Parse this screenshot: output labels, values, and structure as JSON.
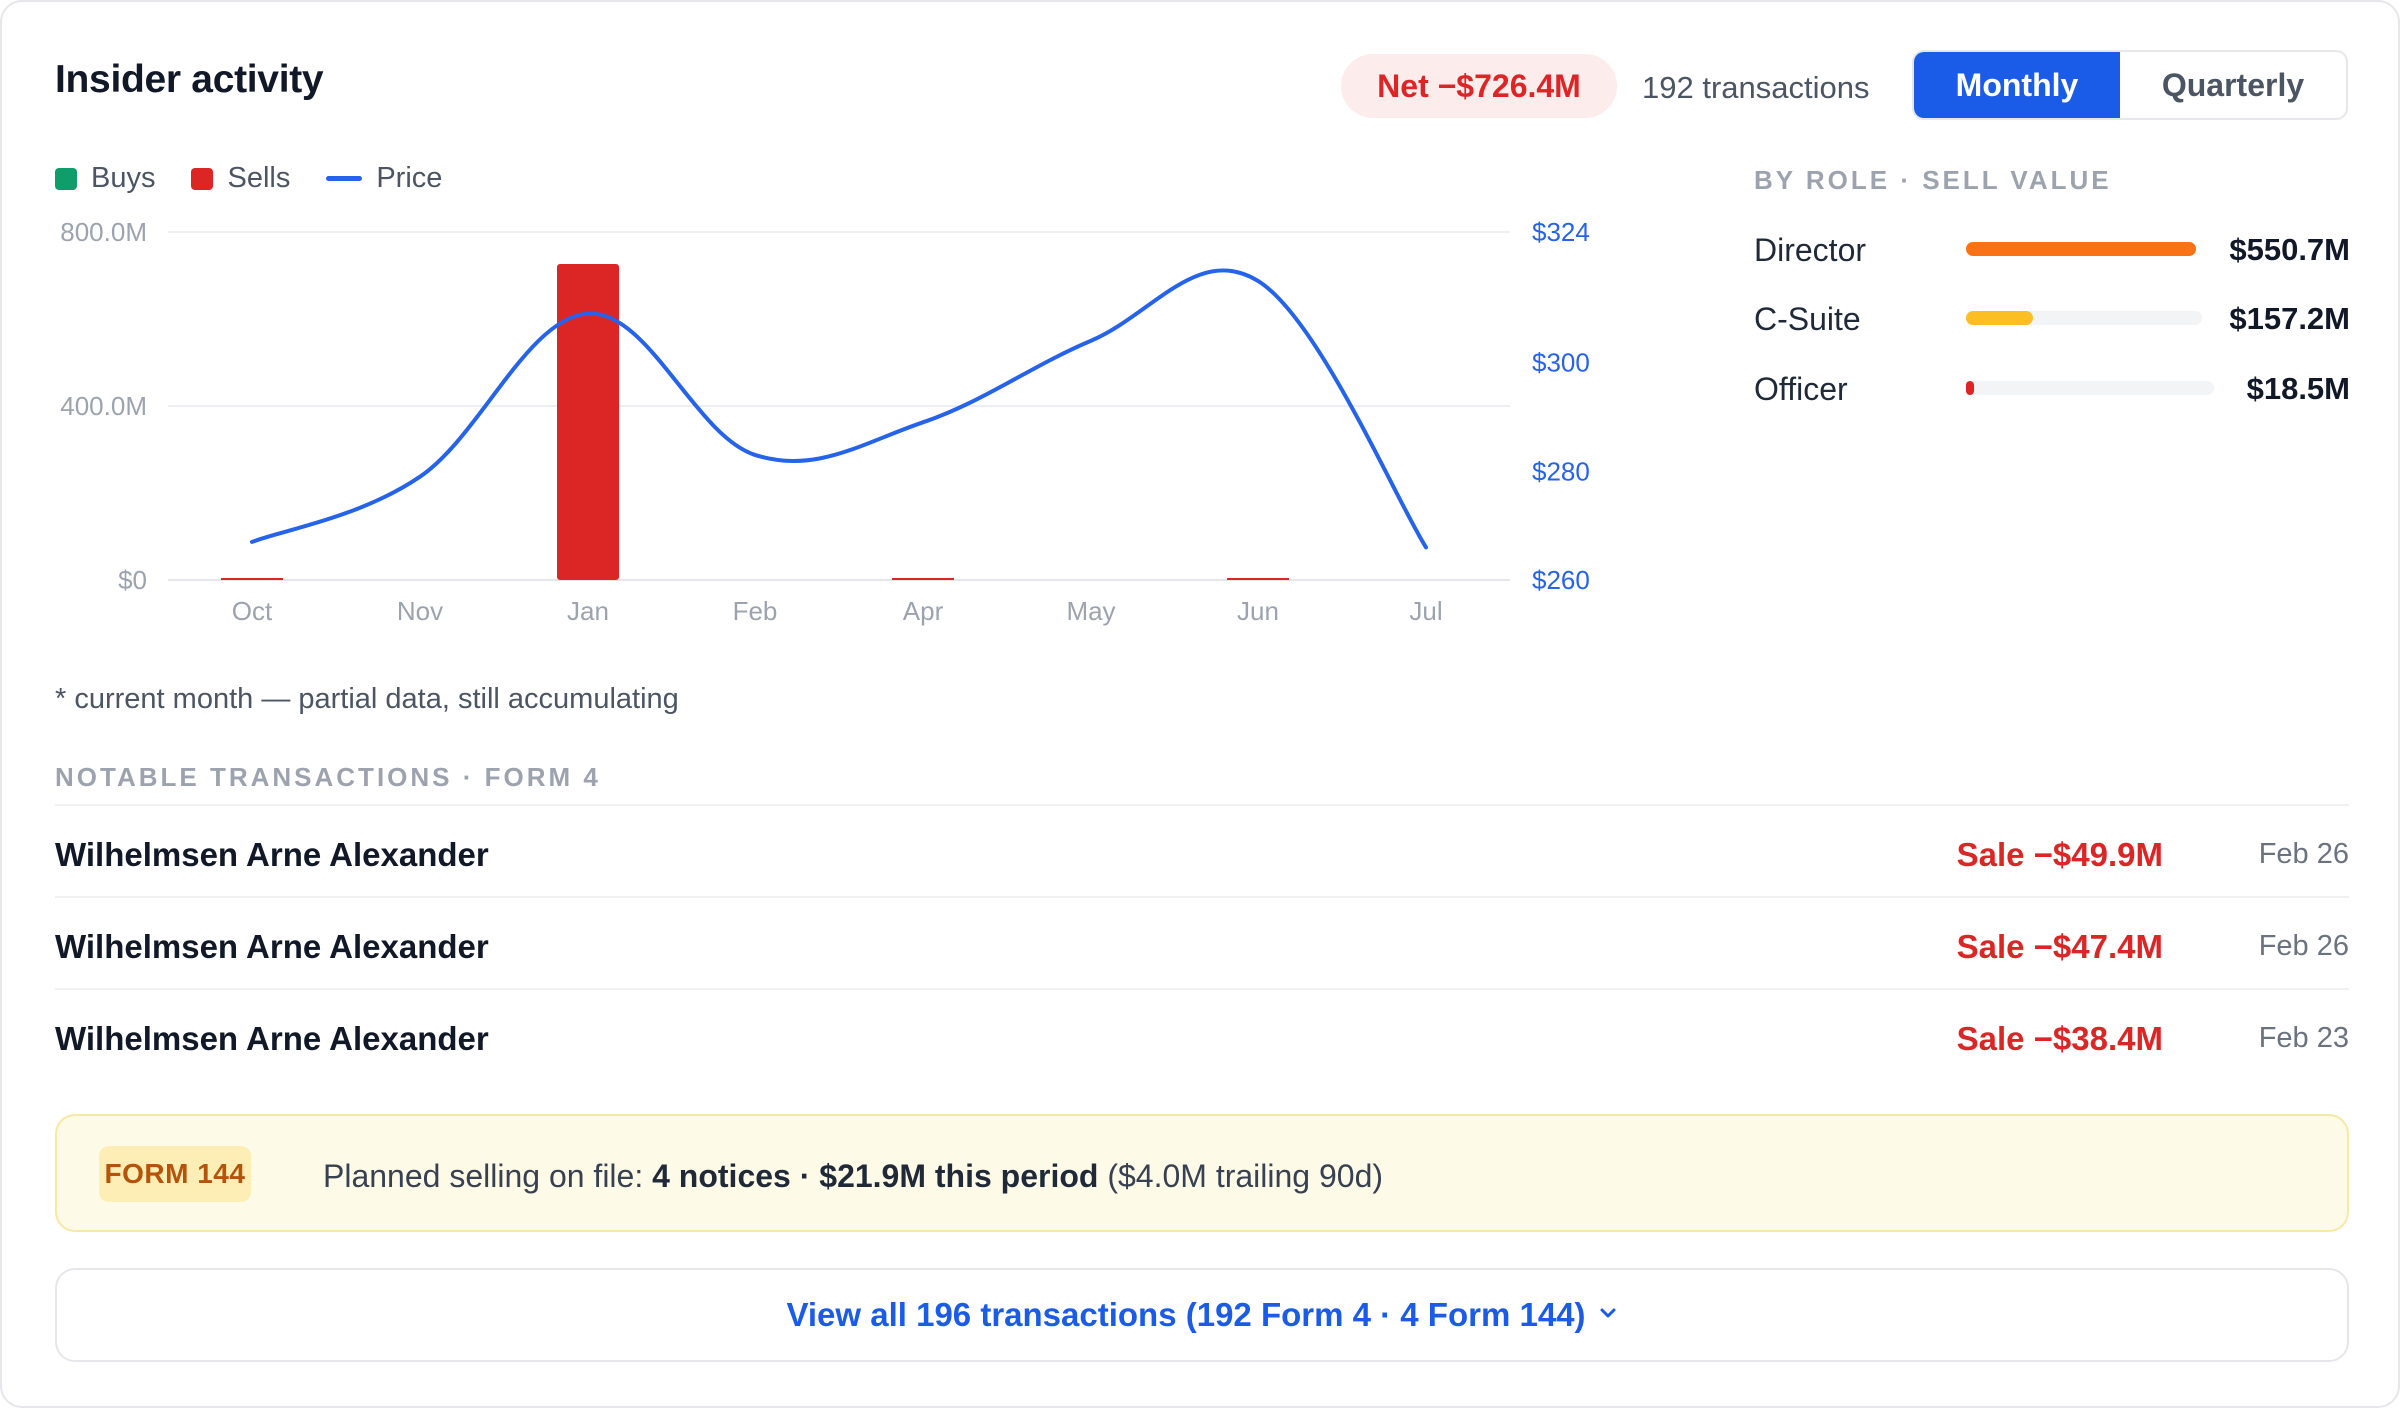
{
  "header": {
    "title": "Insider activity",
    "net_badge": "Net −$726.4M",
    "transactions": "192 transactions",
    "toggle": {
      "monthly": "Monthly",
      "quarterly": "Quarterly",
      "selected": "Monthly"
    }
  },
  "legend": {
    "buys": "Buys",
    "sells": "Sells",
    "price": "Price"
  },
  "colors": {
    "buys": "#0f9d6b",
    "sells": "#dc2626",
    "price": "#2563eb",
    "director": "#f97316",
    "csuite": "#fbbf24",
    "officer": "#dc2626",
    "accent": "#1a5ce8"
  },
  "chart_data": {
    "type": "bar",
    "categories": [
      "Oct",
      "Nov",
      "Jan",
      "Feb",
      "Apr",
      "May",
      "Jun",
      "Jul"
    ],
    "series": [
      {
        "name": "Buys",
        "axis": "left",
        "values": [
          0,
          0,
          0,
          0,
          0,
          0,
          0,
          0
        ]
      },
      {
        "name": "Sells",
        "axis": "left",
        "values": [
          0.5,
          0,
          726.4,
          0,
          0.5,
          0,
          2,
          0
        ]
      },
      {
        "name": "Price",
        "axis": "right",
        "type": "line",
        "values": [
          267,
          279,
          309,
          283,
          289,
          304,
          315,
          266
        ]
      }
    ],
    "left_axis": {
      "ticks": [
        "$0",
        "400.0M",
        "800.0M"
      ],
      "tick_values": [
        0,
        400,
        800
      ],
      "range": [
        0,
        800
      ]
    },
    "right_axis": {
      "ticks": [
        "$260",
        "$280",
        "$300",
        "$324"
      ],
      "tick_values": [
        260,
        280,
        300,
        324
      ],
      "range": [
        260,
        324
      ]
    },
    "grid": true
  },
  "footnote": "* current month — partial data, still accumulating",
  "by_role": {
    "heading": "BY ROLE · SELL VALUE",
    "items": [
      {
        "label": "Director",
        "value": "$550.7M",
        "fraction": 1.0
      },
      {
        "label": "C-Suite",
        "value": "$157.2M",
        "fraction": 0.285
      },
      {
        "label": "Officer",
        "value": "$18.5M",
        "fraction": 0.034
      }
    ]
  },
  "notable": {
    "heading": "NOTABLE TRANSACTIONS · FORM 4",
    "rows": [
      {
        "name": "Wilhelmsen Arne Alexander",
        "amount": "Sale −$49.9M",
        "date": "Feb 26"
      },
      {
        "name": "Wilhelmsen Arne Alexander",
        "amount": "Sale −$47.4M",
        "date": "Feb 26"
      },
      {
        "name": "Wilhelmsen Arne Alexander",
        "amount": "Sale −$38.4M",
        "date": "Feb 23"
      }
    ]
  },
  "form144": {
    "tag": "FORM 144",
    "prefix": "Planned selling on file: ",
    "bold": "4 notices · $21.9M this period",
    "suffix": " ($4.0M trailing 90d)"
  },
  "view_all": {
    "label": "View all 196 transactions (192 Form 4 · 4 Form 144)",
    "icon": "chevron-down-icon"
  }
}
